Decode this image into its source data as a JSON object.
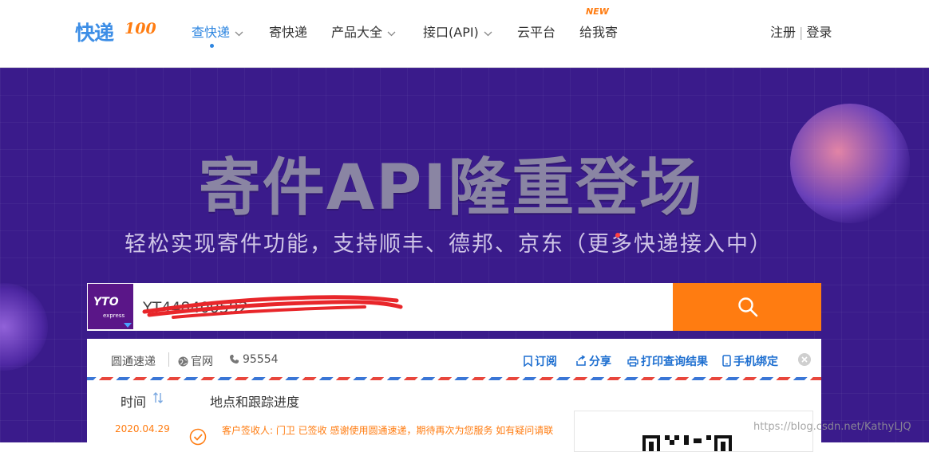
{
  "brand": {
    "logo_text": "快递",
    "logo_number": "100"
  },
  "nav": {
    "items": [
      {
        "label": "查快递",
        "active": true,
        "caret": true
      },
      {
        "label": "寄快递",
        "active": false,
        "caret": false
      },
      {
        "label": "产品大全",
        "active": false,
        "caret": true
      },
      {
        "label": "接口(API)",
        "active": false,
        "caret": true
      },
      {
        "label": "云平台",
        "active": false,
        "caret": false
      },
      {
        "label": "给我寄",
        "active": false,
        "caret": false
      }
    ],
    "new_badge": "NEW"
  },
  "auth": {
    "register": "注册",
    "separator": "|",
    "login": "登录"
  },
  "hero": {
    "title": "寄件API隆重登场",
    "subtitle": "轻松实现寄件功能，支持顺丰、德邦、京东（更多快递接入中）"
  },
  "search": {
    "carrier_logo_text": "YTO",
    "carrier_logo_sub": "express",
    "value": "YT448400592..."
  },
  "result": {
    "carrier_name": "圆通速递",
    "website_label": "官网",
    "phone": "95554",
    "actions": {
      "subscribe": "订阅",
      "share": "分享",
      "print": "打印查询结果",
      "bind_phone": "手机绑定"
    },
    "columns": {
      "time": "时间",
      "progress": "地点和跟踪进度"
    },
    "rows": [
      {
        "date": "2020.04.29",
        "text": "客户签收人: 门卫 已签收 感谢使用圆通速递，期待再次为您服务 如有疑问请联"
      }
    ]
  },
  "watermark": "https://blog.csdn.net/KathyLJQ",
  "colors": {
    "accent_blue": "#2e86e0",
    "brand_orange": "#ff7c11",
    "hero_purple": "#3a1b8b",
    "link_blue": "#1e6fd0"
  }
}
